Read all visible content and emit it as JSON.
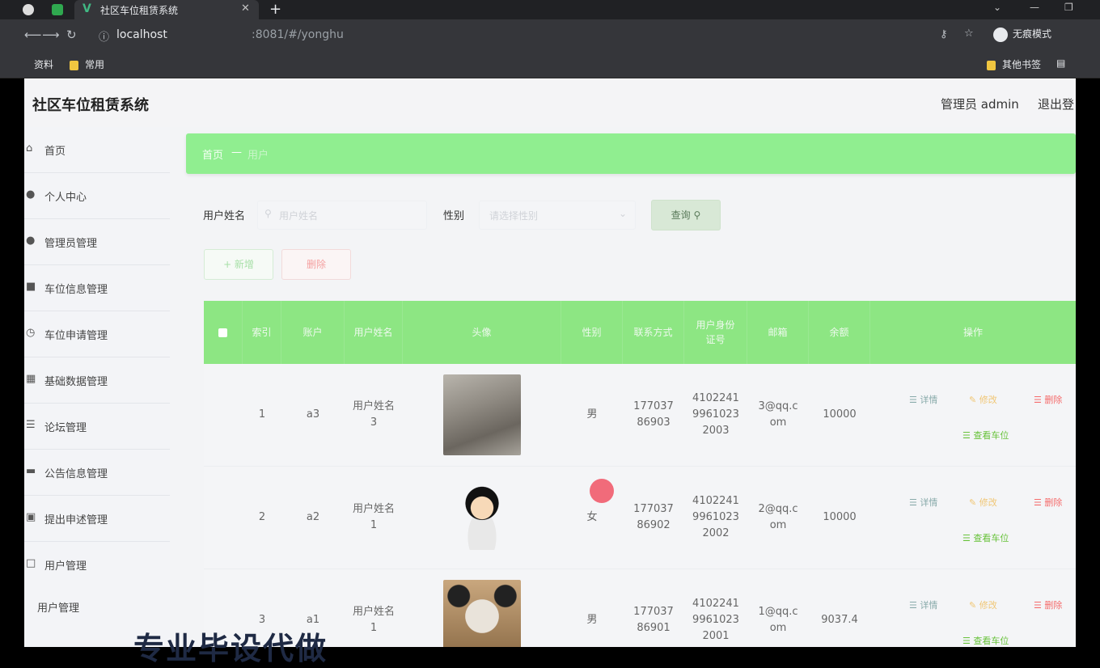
{
  "browser": {
    "tab_title": "社区车位租赁系统",
    "url_host": "localhost",
    "url_path": ":8081/#/yonghu",
    "incognito_label": "无痕模式",
    "bookmarks": [
      "资料",
      "常用"
    ],
    "other_bookmarks": "其他书签"
  },
  "header": {
    "title": "社区车位租赁系统",
    "admin": "管理员 admin",
    "logout": "退出登"
  },
  "sidebar": {
    "items": [
      {
        "label": "首页",
        "icon": "home-icon"
      },
      {
        "label": "个人中心",
        "icon": "user-icon"
      },
      {
        "label": "管理员管理",
        "icon": "user-icon"
      },
      {
        "label": "车位信息管理",
        "icon": "folder-icon"
      },
      {
        "label": "车位申请管理",
        "icon": "clock-icon"
      },
      {
        "label": "基础数据管理",
        "icon": "grid-icon"
      },
      {
        "label": "论坛管理",
        "icon": "menu-icon"
      },
      {
        "label": "公告信息管理",
        "icon": "message-icon"
      },
      {
        "label": "提出申述管理",
        "icon": "lock-icon"
      },
      {
        "label": "用户管理",
        "icon": "box-icon"
      }
    ],
    "submenu": "用户管理"
  },
  "breadcrumb": {
    "home": "首页",
    "separator": "—",
    "current": "用户"
  },
  "search": {
    "name_label": "用户姓名",
    "name_placeholder": "用户姓名",
    "gender_label": "性别",
    "gender_placeholder": "请选择性别",
    "query_button": "查询"
  },
  "toolbar": {
    "add": "+ 新增",
    "delete": "删除"
  },
  "table": {
    "headers": [
      "",
      "索引",
      "账户",
      "用户姓名",
      "头像",
      "性别",
      "联系方式",
      "用户身份证号",
      "邮箱",
      "余额",
      "操作"
    ],
    "rows": [
      {
        "index": "1",
        "account": "a3",
        "name": "用户姓名3",
        "gender": "男",
        "phone": "17703786903",
        "idcard": "410224199610232003",
        "email": "3@qq.com",
        "balance": "10000"
      },
      {
        "index": "2",
        "account": "a2",
        "name": "用户姓名1",
        "gender": "女",
        "phone": "17703786902",
        "idcard": "410224199610232002",
        "email": "2@qq.com",
        "balance": "10000"
      },
      {
        "index": "3",
        "account": "a1",
        "name": "用户姓名1",
        "gender": "男",
        "phone": "17703786901",
        "idcard": "410224199610232001",
        "email": "1@qq.com",
        "balance": "9037.4"
      }
    ],
    "actions": {
      "detail": "详情",
      "edit": "修改",
      "delete": "删除",
      "view": "查看车位"
    }
  },
  "watermark": "专业毕设代做",
  "colors": {
    "accent": "#90ee90",
    "danger": "#f56c6c",
    "warning": "#e6a23c"
  }
}
